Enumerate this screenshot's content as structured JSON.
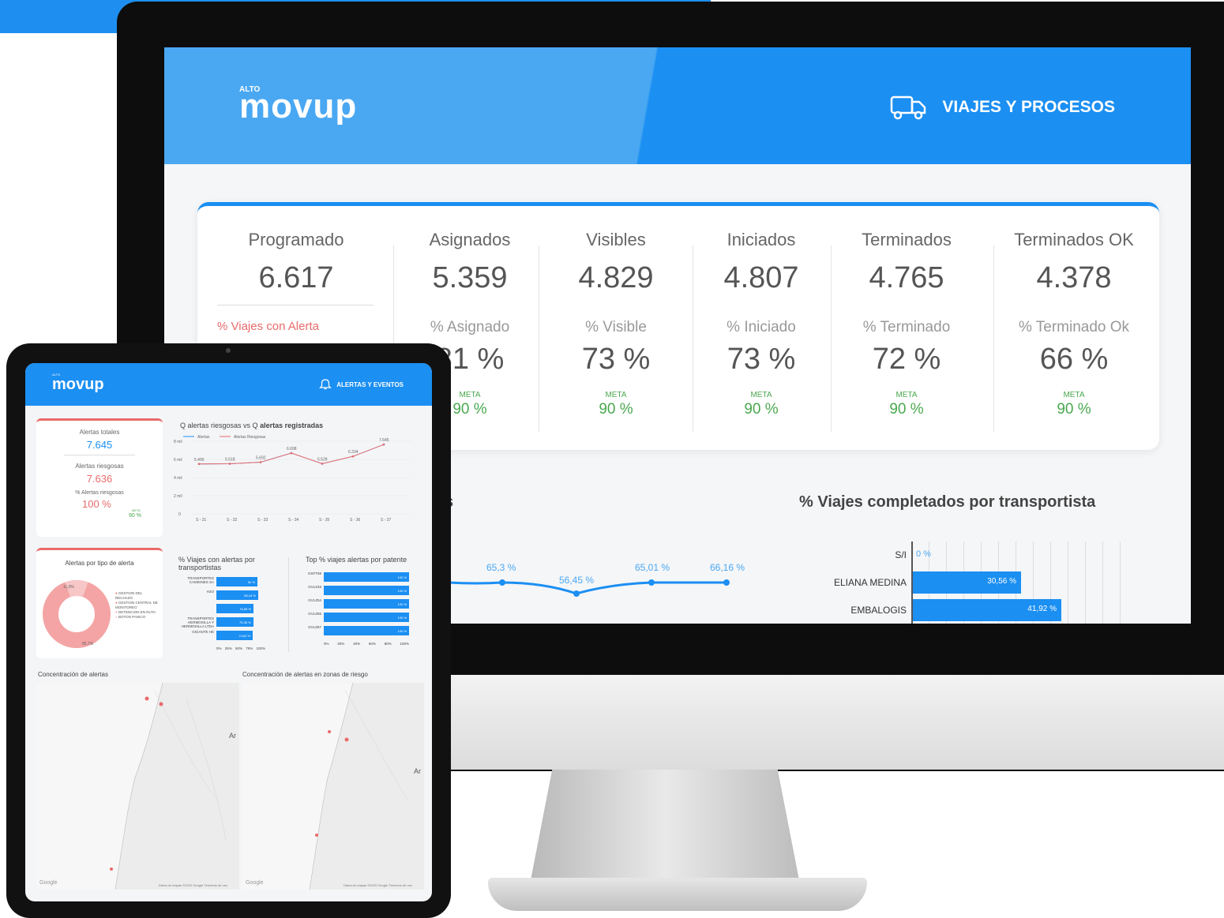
{
  "monitor": {
    "brand": {
      "alto": "ALTO",
      "name": "movup"
    },
    "header_title": "VIAJES Y PROCESOS",
    "kpis": [
      {
        "title": "Programado",
        "value": "6.617",
        "label": "% Viajes con Alerta",
        "pct": "",
        "meta_label": "META",
        "meta_value": ""
      },
      {
        "title": "Asignados",
        "value": "5.359",
        "label": "% Asignado",
        "pct": "81 %",
        "meta_label": "META",
        "meta_value": "90 %"
      },
      {
        "title": "Visibles",
        "value": "4.829",
        "label": "% Visible",
        "pct": "73 %",
        "meta_label": "META",
        "meta_value": "90 %"
      },
      {
        "title": "Iniciados",
        "value": "4.807",
        "label": "% Iniciado",
        "pct": "73 %",
        "meta_label": "META",
        "meta_value": "90 %"
      },
      {
        "title": "Terminados",
        "value": "4.765",
        "label": "% Terminado",
        "pct": "72 %",
        "meta_label": "META",
        "meta_value": "90 %"
      },
      {
        "title": "Terminados OK",
        "value": "4.378",
        "label": "% Terminado Ok",
        "pct": "66 %",
        "meta_label": "META",
        "meta_value": "90 %"
      }
    ],
    "section_left_fragment": "s",
    "section_right_title": "% Viajes completados por transportista",
    "line_points": [
      "65,3 %",
      "56,45 %",
      "65,01 %",
      "66,16 %"
    ],
    "bars": [
      {
        "label": "S/I",
        "value_text": "0 %"
      },
      {
        "label": "ELIANA MEDINA",
        "value_text": "30,56 %"
      },
      {
        "label": "EMBALOGIS",
        "value_text": "41,92 %"
      }
    ]
  },
  "tablet": {
    "brand": {
      "alto": "ALTO",
      "name": "movup"
    },
    "header_title": "ALERTAS Y EVENTOS",
    "summary": {
      "total_label": "Alertas totales",
      "total_value": "7.645",
      "risk_label": "Alertas riesgosas",
      "risk_value": "7.636",
      "pct_label": "% Alertas riesgosas",
      "pct_value": "100 %",
      "meta_label": "META",
      "meta_value": "90 %"
    },
    "line_chart": {
      "title_prefix": "Q alertas riesgosas vs Q",
      "title_bold": "alertas registradas",
      "legend": [
        "Alertas",
        "Alertas Riesgosas"
      ],
      "y_ticks": [
        "8 mil",
        "6 mil",
        "4 mil",
        "2 mil",
        "0"
      ],
      "x_ticks": [
        "S - 31",
        "S - 32",
        "S - 33",
        "S - 34",
        "S - 35",
        "S - 36",
        "S - 37"
      ],
      "labels": [
        "5.495",
        "5.518",
        "5.692",
        "6.698",
        "5.528",
        "6.334",
        "7.645"
      ]
    },
    "pie": {
      "title": "Alertas por tipo de alerta",
      "labels": [
        "11,0%",
        "85,7%"
      ],
      "legend": [
        "GESTION DEL RECHAZO",
        "GESTION CENTRAL DE MONITOREO",
        "DETENCION EN RUTA",
        "BOTON PANICO"
      ]
    },
    "bar1": {
      "title": "% Viajes con alertas por transportistas",
      "categories": [
        "TRANSPORTES CAMIONES SA",
        "H2O",
        "",
        "TRANSPORTES HERMOSILLA Y HERMOSILLA LTDA",
        "GIGANTE HE"
      ],
      "value_texts": [
        "84 %",
        "85,44 %",
        "75,85 %",
        "75,36 %",
        "74,52 %"
      ],
      "x_ticks": [
        "0%",
        "25%",
        "50%",
        "75%",
        "100%"
      ]
    },
    "bar2": {
      "title": "Top % viajes alertas por patente",
      "categories": [
        "GSFT68",
        "GVLZ48",
        "GVLZ54",
        "GVLZ55",
        "GVLZ67"
      ],
      "value_texts": [
        "100 %",
        "100 %",
        "100 %",
        "100 %",
        "100 %"
      ],
      "x_ticks": [
        "0%",
        "20%",
        "40%",
        "60%",
        "80%",
        "100%"
      ]
    },
    "map1_caption": "Concentración de alertas",
    "map2_caption": "Concentración de alertas en zonas de riesgo",
    "map_footer": "Datos de mapas ©2020 Google   Términos de uso",
    "google": "Google",
    "map_label_ar": "Ar"
  },
  "colors": {
    "blue": "#1b8ff2",
    "light_blue": "#4aa8f2",
    "red": "#e96a6a",
    "green": "#4aa84f"
  },
  "chart_data": [
    {
      "type": "line",
      "title": "Q alertas riesgosas vs Q alertas registradas",
      "categories": [
        "S - 31",
        "S - 32",
        "S - 33",
        "S - 34",
        "S - 35",
        "S - 36",
        "S - 37"
      ],
      "series": [
        {
          "name": "Alertas",
          "values": [
            5495,
            5518,
            5692,
            6698,
            5528,
            6334,
            7645
          ]
        },
        {
          "name": "Alertas Riesgosas",
          "values": [
            5495,
            5518,
            5692,
            6698,
            5528,
            6334,
            7636
          ]
        }
      ],
      "ylim": [
        0,
        8000
      ]
    },
    {
      "type": "bar",
      "title": "% Viajes completados por transportista",
      "categories": [
        "S/I",
        "ELIANA MEDINA",
        "EMBALOGIS"
      ],
      "values": [
        0,
        30.56,
        41.92
      ]
    },
    {
      "type": "bar",
      "title": "Top % viajes alertas por patente",
      "categories": [
        "GSFT68",
        "GVLZ48",
        "GVLZ54",
        "GVLZ55",
        "GVLZ67"
      ],
      "values": [
        100,
        100,
        100,
        100,
        100
      ]
    }
  ]
}
